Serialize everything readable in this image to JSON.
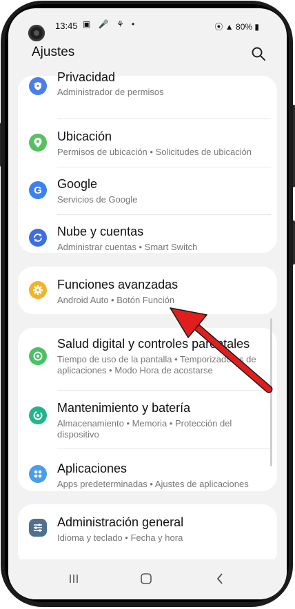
{
  "status": {
    "time": "13:45",
    "battery": "80%"
  },
  "header": {
    "title": "Ajustes"
  },
  "items": [
    {
      "title": "Privacidad",
      "sub": "Administrador de permisos",
      "icon": "shield-icon",
      "color": "#4a7fea"
    },
    {
      "title": "Ubicación",
      "sub": "Permisos de ubicación  •  Solicitudes de ubicación",
      "icon": "location-pin-icon",
      "color": "#57c060"
    },
    {
      "title": "Google",
      "sub": "Servicios de Google",
      "icon": "google-icon",
      "color": "#3b82f0"
    },
    {
      "title": "Nube y cuentas",
      "sub": "Administrar cuentas  •  Smart Switch",
      "icon": "sync-icon",
      "color": "#3d6fe0"
    },
    {
      "title": "Funciones avanzadas",
      "sub": "Android Auto  •  Botón Función",
      "icon": "gear-icon",
      "color": "#f0b429"
    },
    {
      "title": "Salud digital y controles parentales",
      "sub": "Tiempo de uso de la pantalla  •  Temporizadores de aplicaciones  •  Modo Hora de acostarse",
      "icon": "digital-wellbeing-icon",
      "color": "#4cc065"
    },
    {
      "title": "Mantenimiento y batería",
      "sub": "Almacenamiento  •  Memoria  •  Protección del dispositivo",
      "icon": "device-care-icon",
      "color": "#1fb58f"
    },
    {
      "title": "Aplicaciones",
      "sub": "Apps predeterminadas  •  Ajustes de aplicaciones",
      "icon": "apps-icon",
      "color": "#4a9ee8"
    },
    {
      "title": "Administración general",
      "sub": "Idioma y teclado  •  Fecha y hora",
      "icon": "sliders-icon",
      "color": "#51708f"
    }
  ],
  "colors": {
    "arrow": "#e01e1e",
    "screen_bg": "#f2f2f2",
    "card_bg": "#ffffff"
  }
}
